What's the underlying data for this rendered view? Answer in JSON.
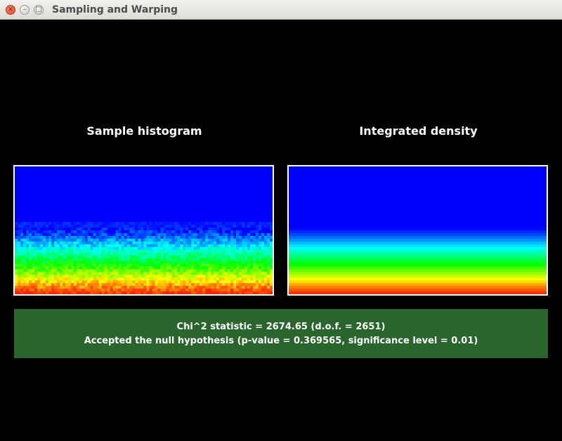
{
  "window": {
    "title": "Sampling and Warping",
    "close_icon": "close-icon",
    "minimize_icon": "minimize-icon",
    "maximize_icon": "maximize-icon"
  },
  "panels": {
    "histogram": {
      "title": "Sample histogram"
    },
    "density": {
      "title": "Integrated density"
    }
  },
  "colormap": {
    "stops": [
      "#0000ff",
      "#0080ff",
      "#00ffff",
      "#00ff80",
      "#00ff00",
      "#80ff00",
      "#ffff00",
      "#ff8000",
      "#ff2000"
    ]
  },
  "test": {
    "statistic_line": "Chi^2 statistic = 2674.65 (d.o.f. = 2651)",
    "result_line": "Accepted the null hypothesis (p-value = 0.369565, significance level = 0.01)",
    "status": "accepted",
    "status_color": "#2a652e"
  }
}
